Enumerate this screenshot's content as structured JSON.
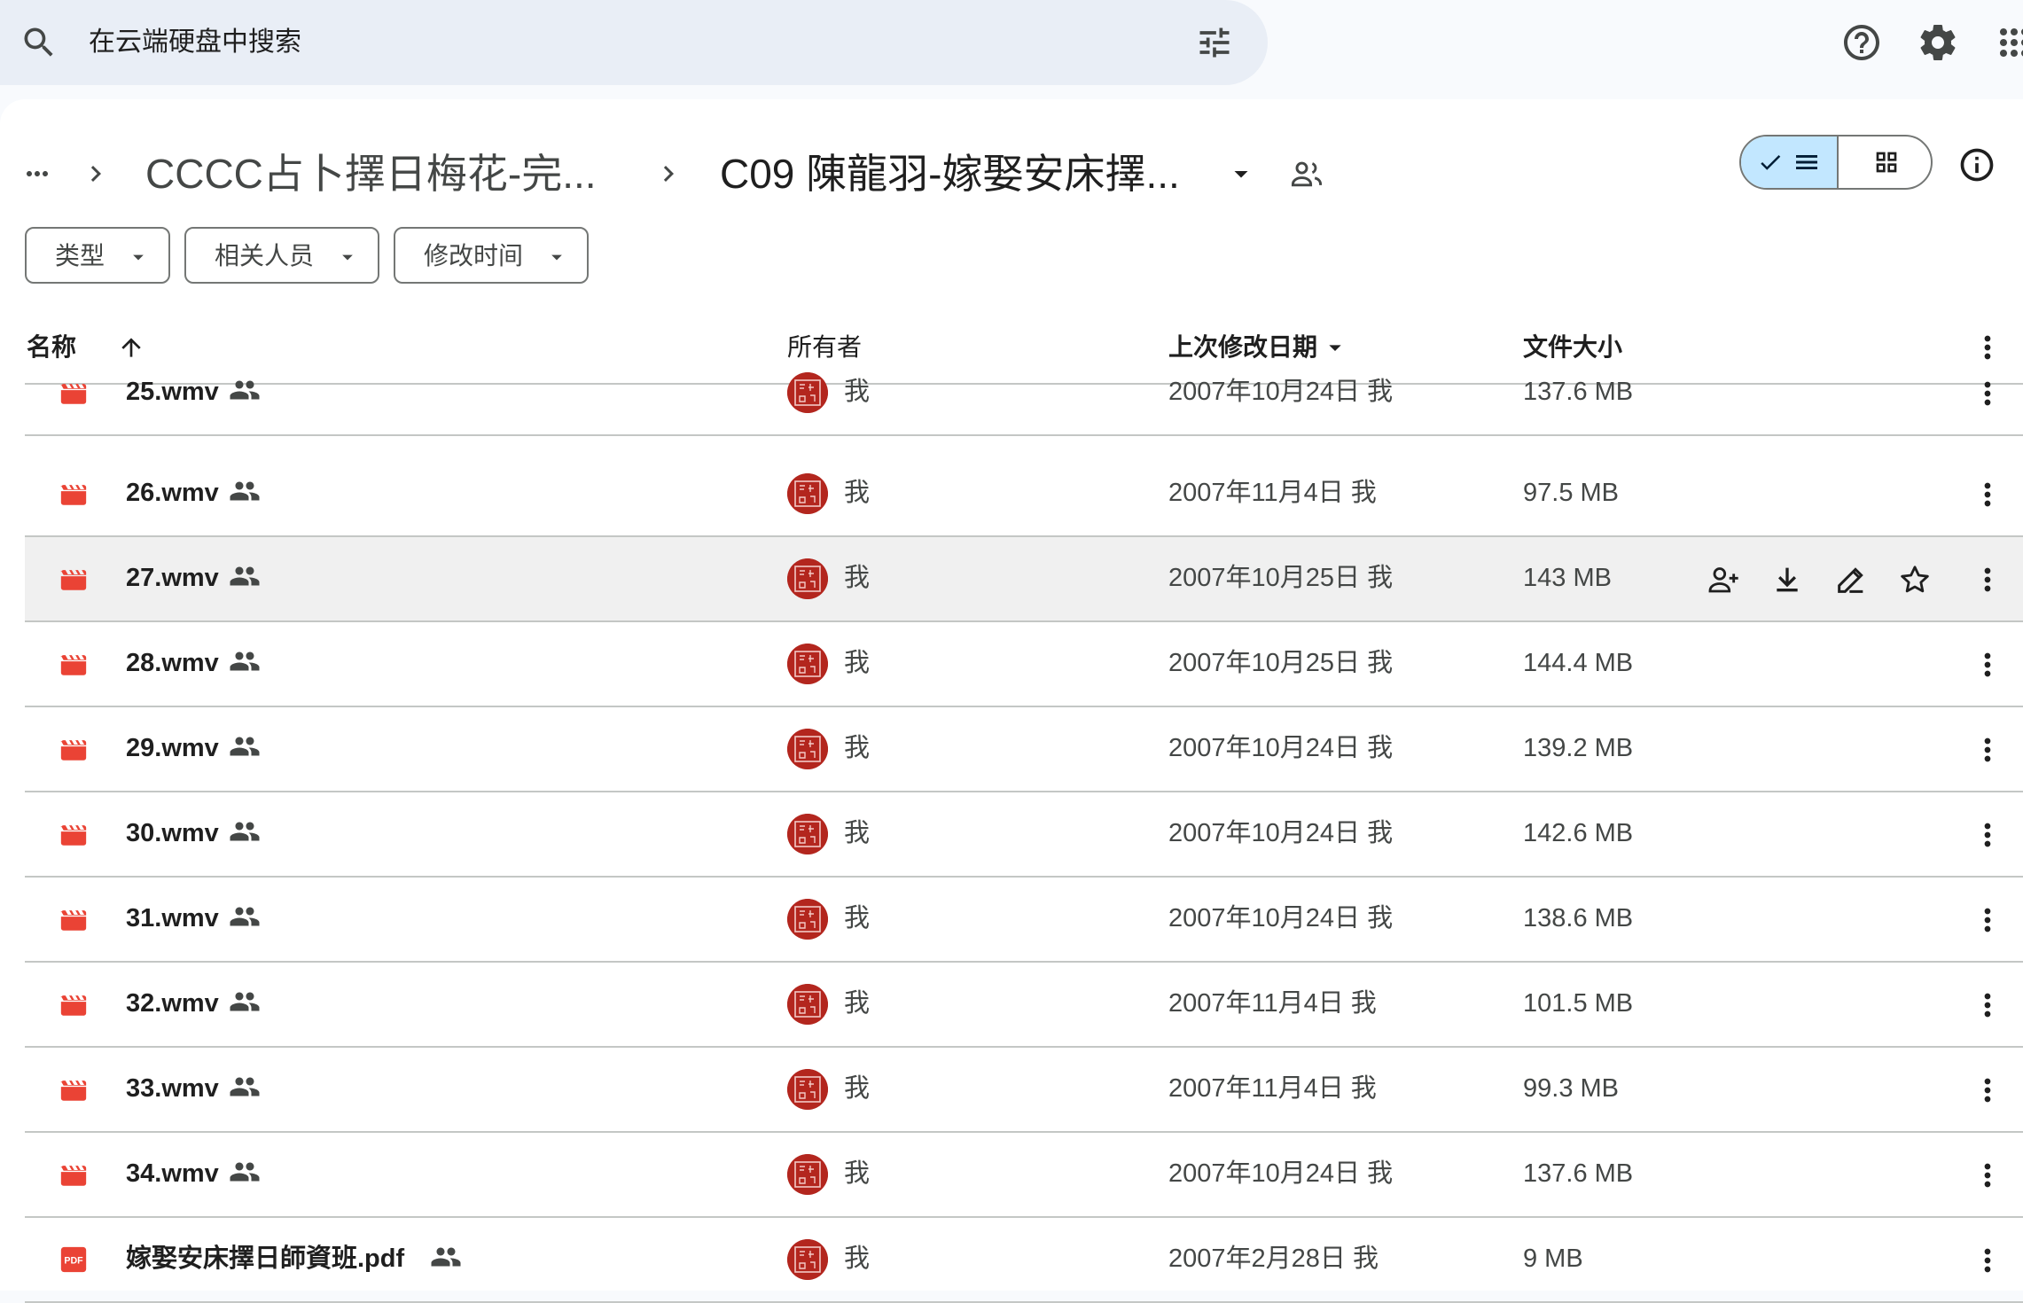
{
  "search": {
    "placeholder": "在云端硬盘中搜索"
  },
  "header_icons": [
    "help-icon",
    "settings-icon",
    "apps-icon"
  ],
  "breadcrumb": {
    "parent": "CCCC占卜擇日梅花-完...",
    "current": "C09 陳龍羽-嫁娶安床擇..."
  },
  "filters": [
    "类型",
    "相关人员",
    "修改时间"
  ],
  "columns": {
    "name": "名称",
    "owner": "所有者",
    "modified": "上次修改日期",
    "size": "文件大小"
  },
  "rows": [
    {
      "name": "25.wmv",
      "type": "video",
      "owner": "我",
      "modified": "2007年10月24日 我",
      "size": "137.6 MB"
    },
    {
      "name": "26.wmv",
      "type": "video",
      "owner": "我",
      "modified": "2007年11月4日 我",
      "size": "97.5 MB"
    },
    {
      "name": "27.wmv",
      "type": "video",
      "owner": "我",
      "modified": "2007年10月25日 我",
      "size": "143 MB",
      "hovered": true
    },
    {
      "name": "28.wmv",
      "type": "video",
      "owner": "我",
      "modified": "2007年10月25日 我",
      "size": "144.4 MB"
    },
    {
      "name": "29.wmv",
      "type": "video",
      "owner": "我",
      "modified": "2007年10月24日 我",
      "size": "139.2 MB"
    },
    {
      "name": "30.wmv",
      "type": "video",
      "owner": "我",
      "modified": "2007年10月24日 我",
      "size": "142.6 MB"
    },
    {
      "name": "31.wmv",
      "type": "video",
      "owner": "我",
      "modified": "2007年10月24日 我",
      "size": "138.6 MB"
    },
    {
      "name": "32.wmv",
      "type": "video",
      "owner": "我",
      "modified": "2007年11月4日 我",
      "size": "101.5 MB"
    },
    {
      "name": "33.wmv",
      "type": "video",
      "owner": "我",
      "modified": "2007年11月4日 我",
      "size": "99.3 MB"
    },
    {
      "name": "34.wmv",
      "type": "video",
      "owner": "我",
      "modified": "2007年10月24日 我",
      "size": "137.6 MB"
    },
    {
      "name": "嫁娶安床擇日師資班.pdf",
      "type": "pdf",
      "owner": "我",
      "modified": "2007年2月28日 我",
      "size": "9 MB"
    }
  ],
  "row_actions": [
    "share-icon",
    "download-icon",
    "rename-icon",
    "star-icon"
  ],
  "colors": {
    "accent_blue": "#c2e7ff",
    "file_red": "#ea4335",
    "avatar_red": "#b3261e"
  }
}
